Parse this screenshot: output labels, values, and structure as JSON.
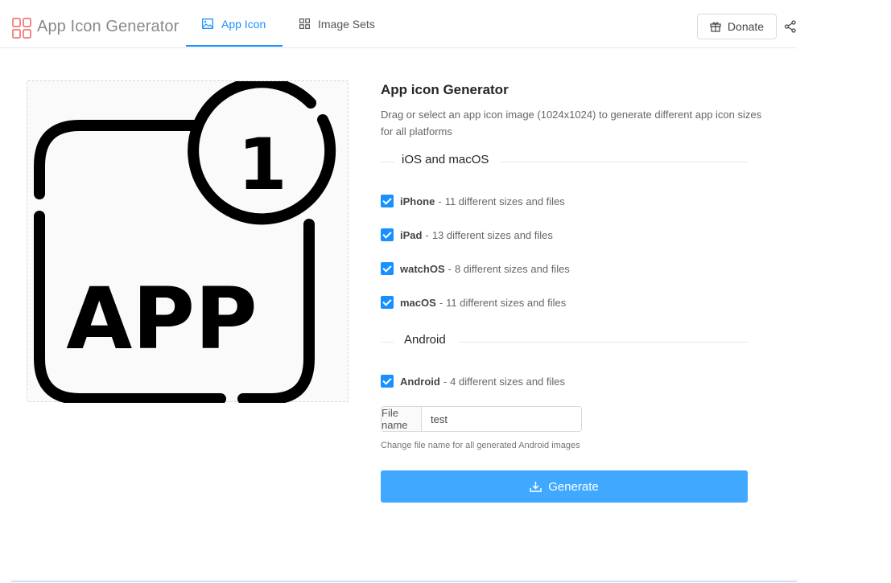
{
  "header": {
    "brand": "App Icon Generator",
    "tabs": [
      {
        "label": "App Icon",
        "icon": "image-icon",
        "active": true
      },
      {
        "label": "Image Sets",
        "icon": "grid-icon",
        "active": false
      }
    ],
    "donate_label": "Donate",
    "accent_color": "#1890ff"
  },
  "preview": {
    "badge_number": "1",
    "icon_text": "APP"
  },
  "panel": {
    "title": "App icon Generator",
    "description": "Drag or select an app icon image (1024x1024) to generate different app icon sizes for all platforms",
    "sections": [
      {
        "heading": "iOS and macOS",
        "options": [
          {
            "name": "iPhone",
            "detail": "11 different sizes and files",
            "checked": true
          },
          {
            "name": "iPad",
            "detail": "13 different sizes and files",
            "checked": true
          },
          {
            "name": "watchOS",
            "detail": "8 different sizes and files",
            "checked": true
          },
          {
            "name": "macOS",
            "detail": "11 different sizes and files",
            "checked": true
          }
        ]
      },
      {
        "heading": "Android",
        "options": [
          {
            "name": "Android",
            "detail": "4 different sizes and files",
            "checked": true
          }
        ]
      }
    ],
    "file_name_label": "File name",
    "file_name_value": "test",
    "file_name_hint": "Change file name for all generated Android images",
    "generate_label": "Generate"
  }
}
